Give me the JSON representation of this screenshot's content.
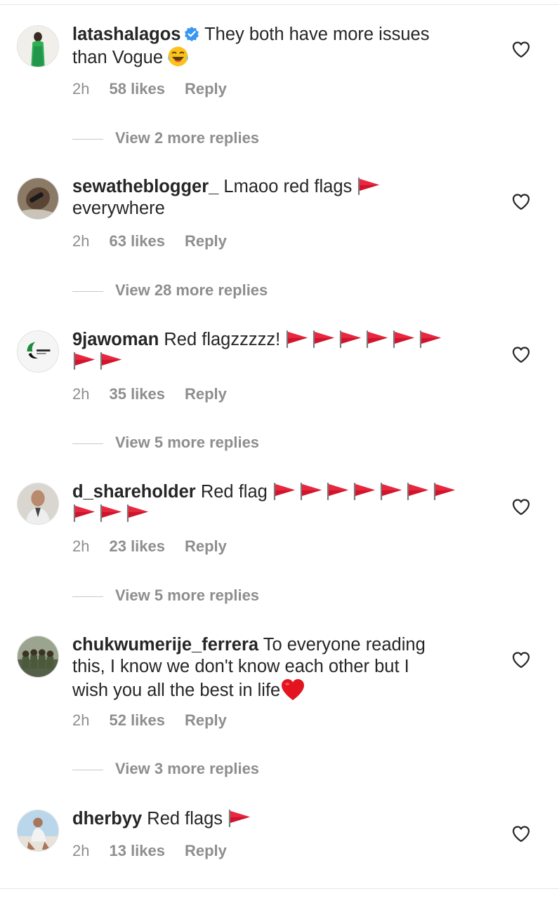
{
  "comments": [
    {
      "username": "latashalagos",
      "verified": true,
      "line1": "They both have more issues",
      "line2": "than Vogue",
      "time": "2h",
      "likes": "58 likes",
      "reply": "Reply",
      "view_more": "View 2 more replies"
    },
    {
      "username": "sewatheblogger_",
      "line1": "Lmaoo red flags",
      "line2": "everywhere",
      "time": "2h",
      "likes": "63 likes",
      "reply": "Reply",
      "view_more": "View 28 more replies"
    },
    {
      "username": "9jawoman",
      "line1": "Red flagzzzzz!",
      "time": "2h",
      "likes": "35 likes",
      "reply": "Reply",
      "view_more": "View 5 more replies"
    },
    {
      "username": "d_shareholder",
      "line1": "Red flag",
      "time": "2h",
      "likes": "23 likes",
      "reply": "Reply",
      "view_more": "View 5 more replies"
    },
    {
      "username": "chukwumerije_ferrera",
      "line1": "To everyone reading",
      "line2": "this, I know we don't know each other but I",
      "line3": "wish you all the best in life",
      "time": "2h",
      "likes": "52 likes",
      "reply": "Reply",
      "view_more": "View 3 more replies"
    },
    {
      "username": "dherbyy",
      "line1": "Red flags",
      "time": "2h",
      "likes": "13 likes",
      "reply": "Reply"
    }
  ],
  "icons": {
    "like": "heart-outline-icon",
    "verified": "verified-badge-icon",
    "flag": "red-flag-emoji",
    "laugh": "laughing-emoji",
    "heart_emoji": "red-heart-emoji"
  },
  "colors": {
    "text": "#262626",
    "secondary": "#8e8e8e",
    "verified_blue": "#3897f0",
    "flag_red": "#c8102e"
  }
}
